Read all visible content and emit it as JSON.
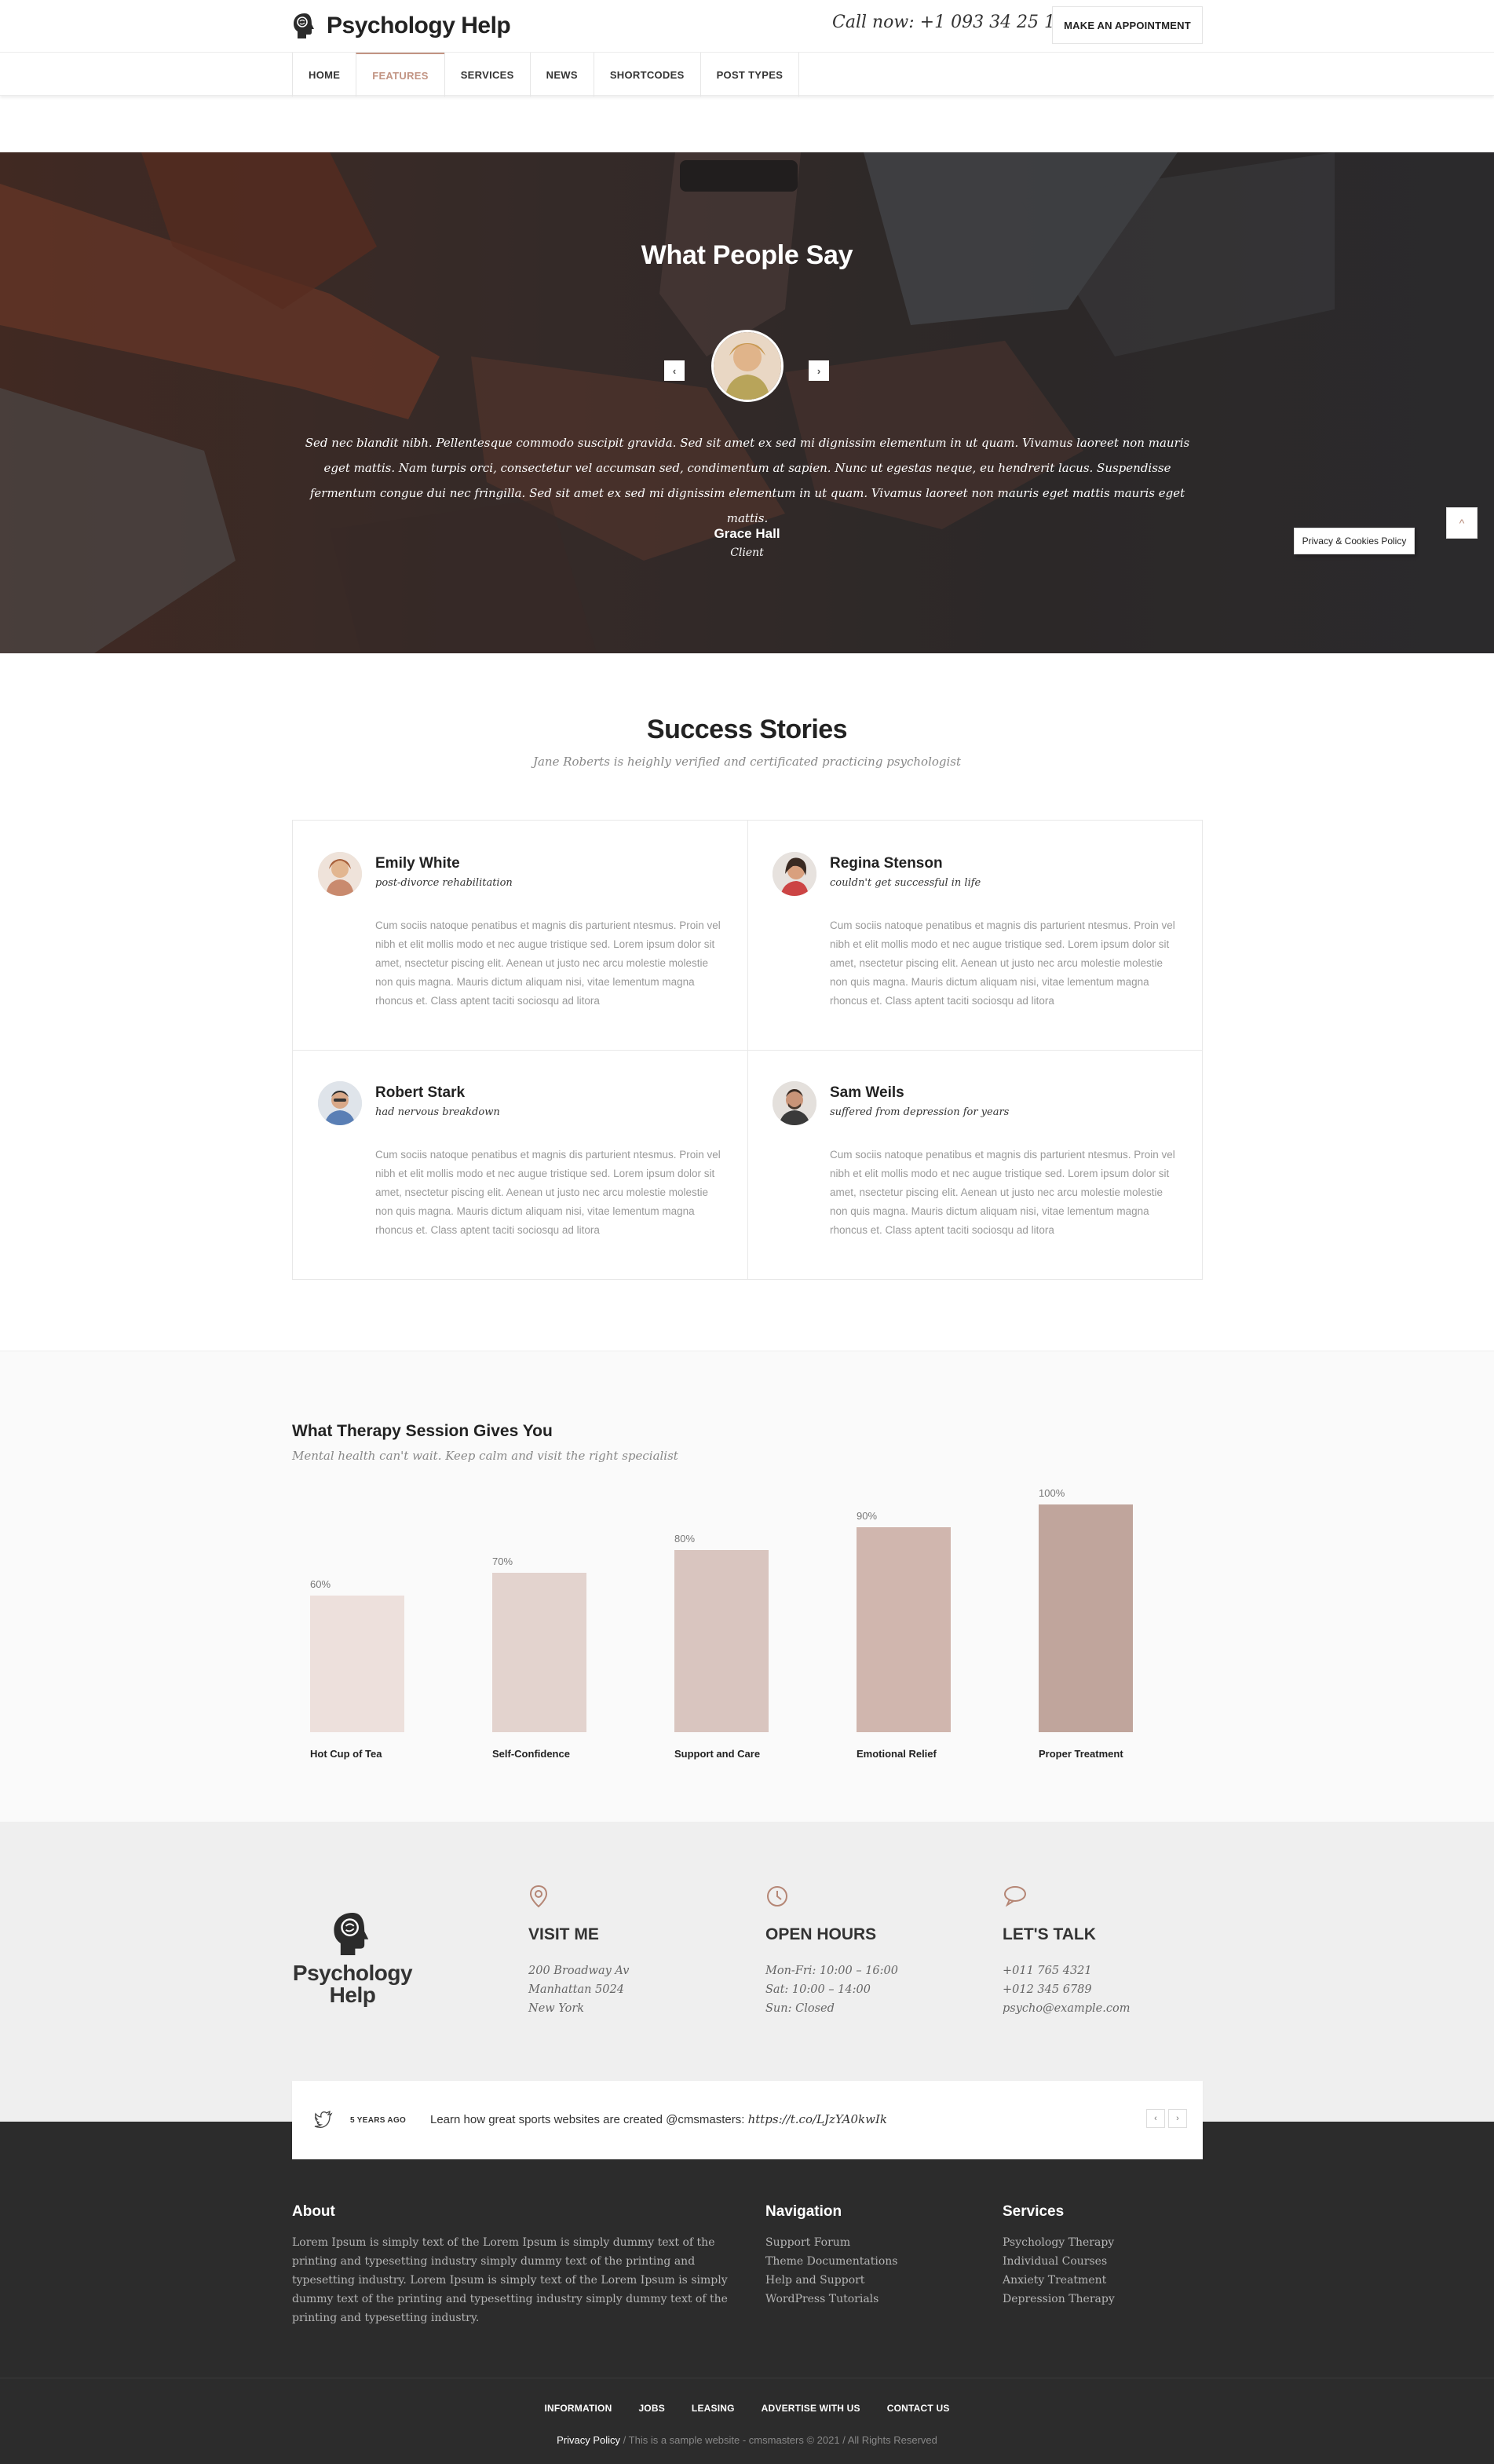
{
  "header": {
    "brand": "Psychology Help",
    "call_now": "Call now: +1 093 34 25 123",
    "appointment_button": "MAKE AN APPOINTMENT",
    "nav": [
      "HOME",
      "FEATURES",
      "SERVICES",
      "NEWS",
      "SHORTCODES",
      "POST TYPES"
    ],
    "active_nav": "FEATURES"
  },
  "testimonials": {
    "title": "What People Say",
    "prev_label": "‹",
    "next_label": "›",
    "quote": "Sed nec blandit nibh. Pellentesque commodo suscipit gravida. Sed sit amet ex sed mi dignissim elementum in ut quam. Vivamus laoreet non mauris eget mattis. Nam turpis orci, consectetur vel accumsan sed, condimentum at sapien. Nunc ut egestas neque, eu hendrerit lacus. Suspendisse fermentum congue dui nec fringilla. Sed sit amet ex sed mi dignissim elementum in ut quam. Vivamus laoreet non mauris eget mattis mauris eget mattis.",
    "name": "Grace Hall",
    "role": "Client"
  },
  "cookie_button": "Privacy & Cookies Policy",
  "to_top_label": "^",
  "success": {
    "title": "Success Stories",
    "subtitle": "Jane Roberts is heighly verified and certificated practicing psychologist",
    "stories": [
      {
        "name": "Emily White",
        "tagline": "post-divorce rehabilitation",
        "text": "Cum sociis natoque penatibus et magnis dis parturient ntesmus. Proin vel nibh et elit mollis modo et nec augue tristique sed. Lorem ipsum dolor sit amet, nsectetur piscing elit. Aenean ut justo nec arcu molestie molestie non quis magna. Mauris dictum aliquam nisi, vitae lementum magna rhoncus et.  Class aptent taciti sociosqu ad litora"
      },
      {
        "name": "Regina Stenson",
        "tagline": "couldn't get successful in life",
        "text": "Cum sociis natoque penatibus et magnis dis parturient ntesmus. Proin vel nibh et elit mollis modo et nec augue tristique sed. Lorem ipsum dolor sit amet, nsectetur piscing elit. Aenean ut justo nec arcu molestie molestie non quis magna. Mauris dictum aliquam nisi, vitae lementum magna rhoncus et.  Class aptent taciti sociosqu ad litora"
      },
      {
        "name": "Robert Stark",
        "tagline": "had nervous breakdown",
        "text": "Cum sociis natoque penatibus et magnis dis parturient ntesmus. Proin vel nibh et elit mollis modo et nec augue tristique sed. Lorem ipsum dolor sit amet, nsectetur piscing elit. Aenean ut justo nec arcu molestie molestie non quis magna. Mauris dictum aliquam nisi, vitae lementum magna rhoncus et.  Class aptent taciti sociosqu ad litora"
      },
      {
        "name": "Sam Weils",
        "tagline": "suffered from depression for years",
        "text": "Cum sociis natoque penatibus et magnis dis parturient ntesmus. Proin vel nibh et elit mollis modo et nec augue tristique sed. Lorem ipsum dolor sit amet, nsectetur piscing elit. Aenean ut justo nec arcu molestie molestie non quis magna. Mauris dictum aliquam nisi, vitae lementum magna rhoncus et.  Class aptent taciti sociosqu ad litora"
      }
    ]
  },
  "therapy": {
    "title": "What Therapy Session Gives You",
    "subtitle": "Mental health can't wait. Keep calm and visit the right specialist"
  },
  "chart_data": {
    "type": "bar",
    "categories": [
      "Hot Cup of Tea",
      "Self-Confidence",
      "Support and Care",
      "Emotional Relief",
      "Proper Treatment"
    ],
    "values": [
      60,
      70,
      80,
      90,
      100
    ],
    "value_labels": [
      "60%",
      "70%",
      "80%",
      "90%",
      "100%"
    ],
    "colors": [
      "#ede0dc",
      "#e3d3ce",
      "#d9c5bf",
      "#d0b6ae",
      "#c0a59c"
    ],
    "ylim": [
      0,
      100
    ],
    "grid": false
  },
  "info": {
    "logo_text_1": "Psychology",
    "logo_text_2": "Help",
    "columns": [
      {
        "icon": "location-pin-icon",
        "heading": "VISIT ME",
        "lines": [
          "200 Broadway Av",
          "Manhattan 5024",
          "New York"
        ]
      },
      {
        "icon": "clock-icon",
        "heading": "OPEN HOURS",
        "lines": [
          "Mon-Fri: 10:00 – 16:00",
          "Sat: 10:00 – 14:00",
          "Sun: Closed"
        ]
      },
      {
        "icon": "speech-bubble-icon",
        "heading": "LET'S TALK",
        "lines": [
          "+011 765 4321",
          "+012 345 6789",
          "psycho@example.com"
        ]
      }
    ],
    "accent_color": "#b58675"
  },
  "tweet": {
    "ago": "5 YEARS AGO",
    "message": "Learn how great sports websites are created @cmsmasters:",
    "link": "https://t.co/LJzYA0kwIk",
    "prev": "‹",
    "next": "›"
  },
  "footer": {
    "about_heading": "About",
    "about_text": "Lorem Ipsum is simply text of the Lorem Ipsum is simply dummy text of the printing and typesetting industry simply dummy text of the printing and typesetting industry. Lorem Ipsum is simply text of the Lorem Ipsum is simply dummy text of the printing and typesetting industry simply dummy text of the printing and typesetting industry.",
    "nav_heading": "Navigation",
    "nav_links": [
      "Support Forum",
      "Theme Documentations",
      "Help and Support",
      "WordPress Tutorials"
    ],
    "services_heading": "Services",
    "services_links": [
      "Psychology Therapy",
      "Individual Courses",
      "Anxiety Treatment",
      "Depression Therapy"
    ],
    "bottom_links": [
      "INFORMATION",
      "JOBS",
      "LEASING",
      "ADVERTISE WITH US",
      "CONTACT US"
    ],
    "privacy": "Privacy Policy",
    "copyright": " / This is a sample website - cmsmasters © 2021 / All Rights Reserved"
  }
}
